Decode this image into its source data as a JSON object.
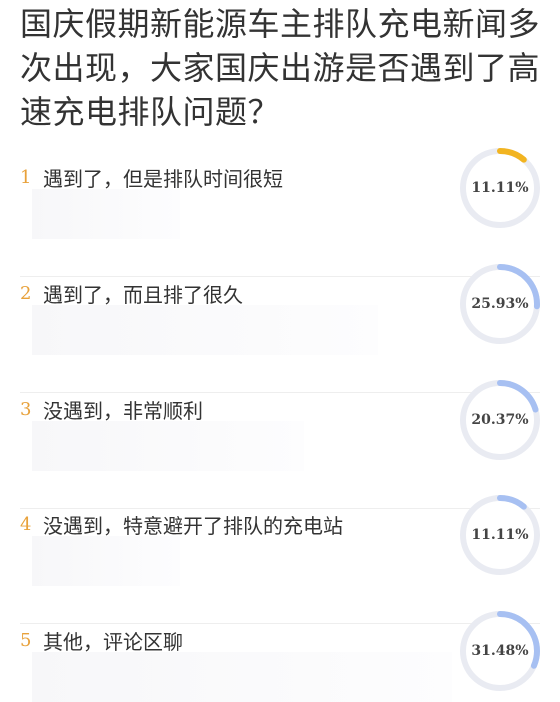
{
  "question": "国庆假期新能源车主排队充电新闻多次出现，大家国庆出游是否遇到了高速充电排队问题？",
  "options": [
    {
      "num": "1",
      "label": "遇到了，但是排队时间很短",
      "percent": "11.11%",
      "fraction": 0.1111,
      "color": "#f2b420"
    },
    {
      "num": "2",
      "label": "遇到了，而且排了很久",
      "percent": "25.93%",
      "fraction": 0.2593,
      "color": "#a7c0f2"
    },
    {
      "num": "3",
      "label": "没遇到，非常顺利",
      "percent": "20.37%",
      "fraction": 0.2037,
      "color": "#a7c0f2"
    },
    {
      "num": "4",
      "label": "没遇到，特意避开了排队的充电站",
      "percent": "11.11%",
      "fraction": 0.1111,
      "color": "#a7c0f2"
    },
    {
      "num": "5",
      "label": "其他，评论区聊",
      "percent": "31.48%",
      "fraction": 0.3148,
      "color": "#a7c0f2"
    }
  ],
  "colors": {
    "track": "#e9ebf2",
    "accent": "#e8a13a",
    "text": "#333333"
  }
}
